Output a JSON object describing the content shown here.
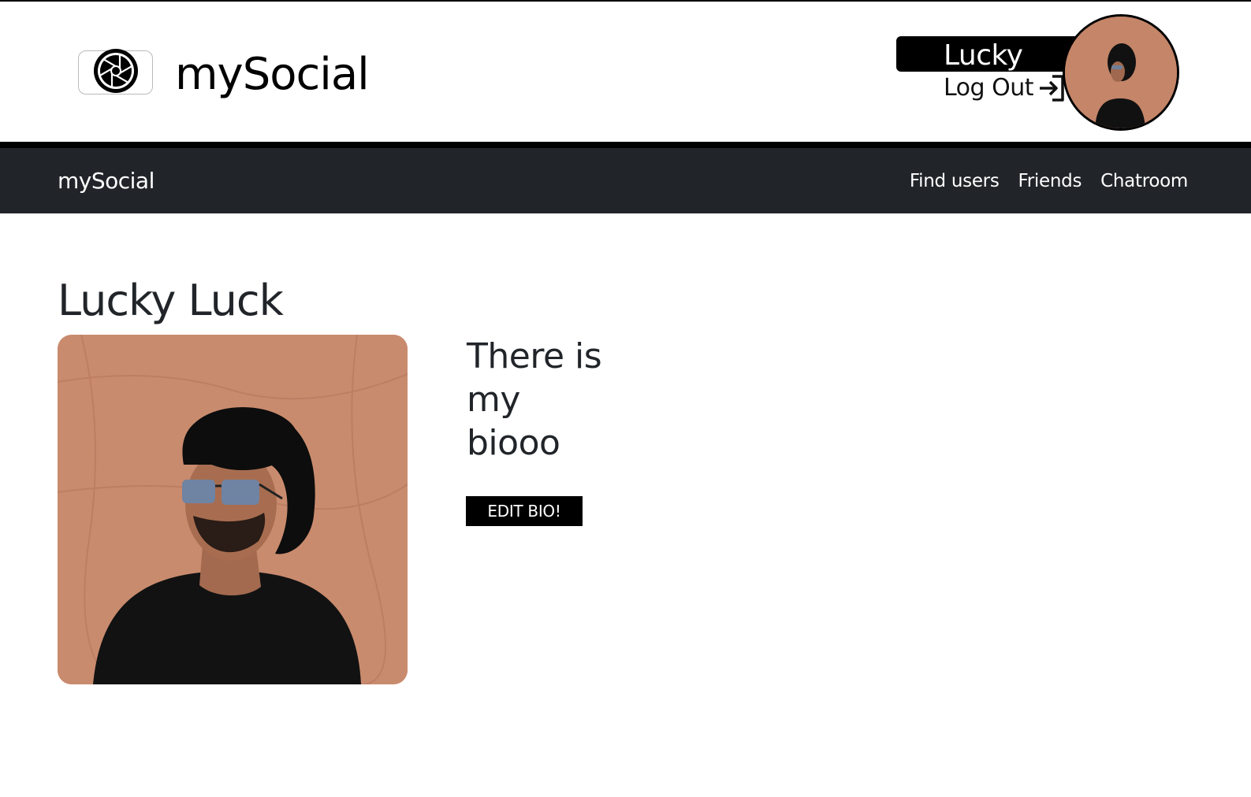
{
  "header": {
    "brand": "mySocial",
    "user_name": "Lucky",
    "logout_label": "Log Out"
  },
  "navbar": {
    "brand": "mySocial",
    "links": [
      {
        "label": "Find users"
      },
      {
        "label": "Friends"
      },
      {
        "label": "Chatroom"
      }
    ]
  },
  "profile": {
    "full_name": "Lucky Luck",
    "bio_lines": [
      "There is",
      "my",
      "biooo"
    ],
    "edit_bio_label": "EDIT BIO!"
  },
  "icons": {
    "logo": "camera-aperture-icon",
    "logout": "log-out-arrow-icon"
  },
  "colors": {
    "navbar_bg": "#212529",
    "accent_black": "#000000",
    "photo_wall": "#c98b6e"
  }
}
